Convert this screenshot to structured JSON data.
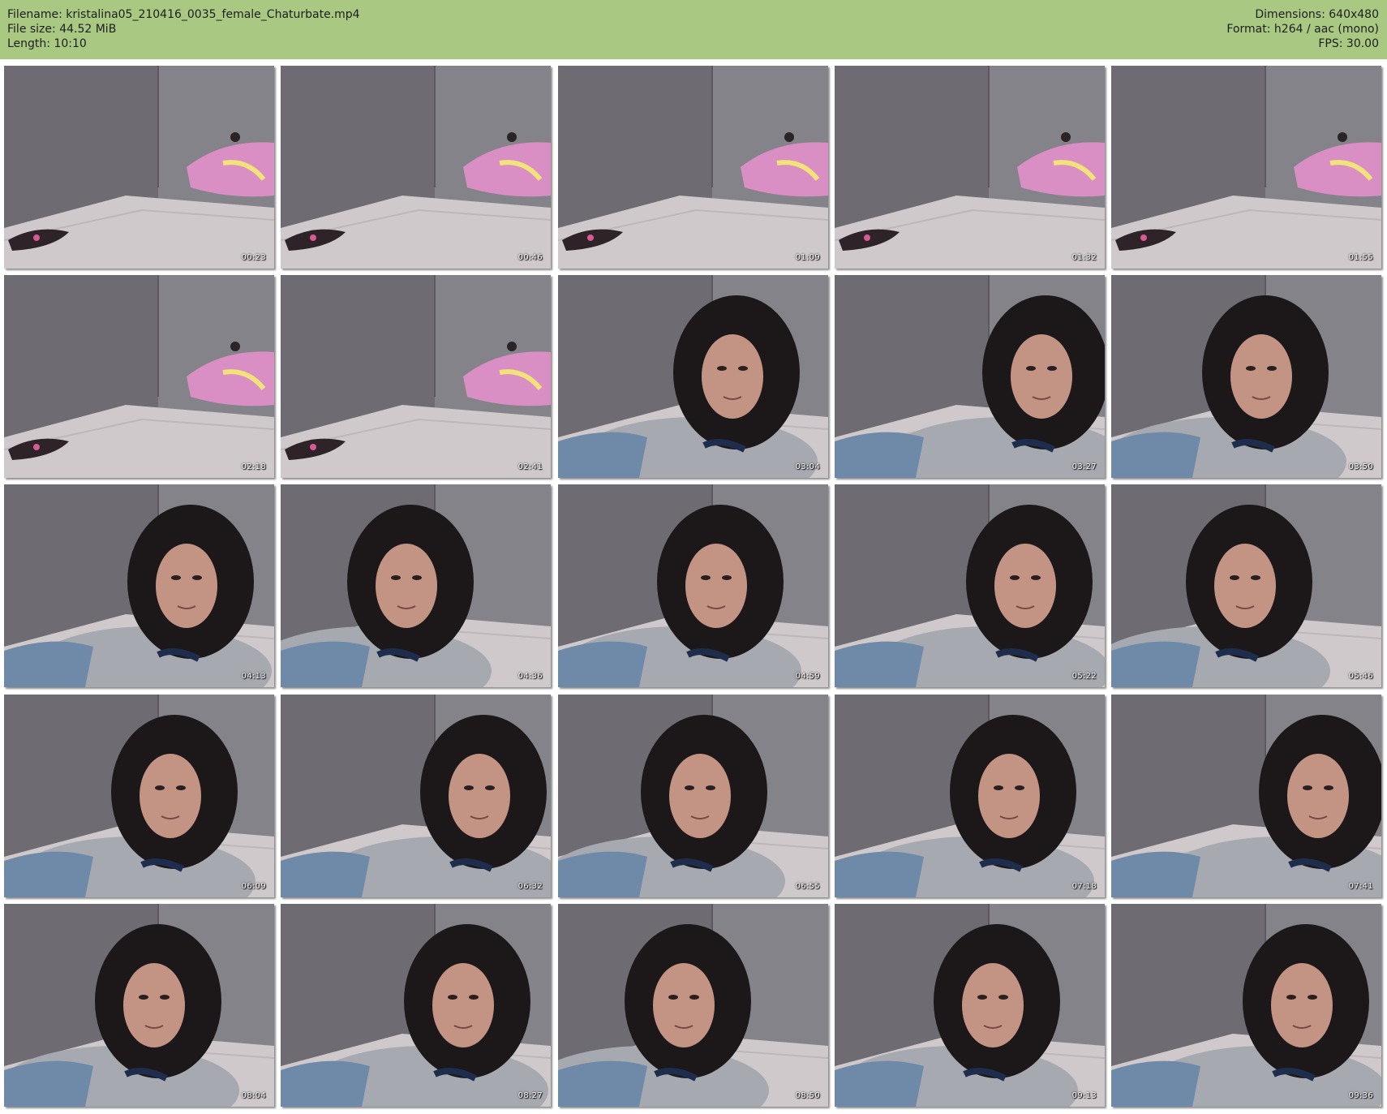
{
  "header": {
    "filename": "Filename: kristalina05_210416_0035_female_Chaturbate.mp4",
    "filesize": "File size: 44.52 MiB",
    "length": "Length: 10:10",
    "dimensions": "Dimensions: 640x480",
    "format": "Format: h264 / aac (mono)",
    "fps": "FPS: 30.00"
  },
  "thumbnails": [
    {
      "time": "00:23",
      "scene": "empty-bed"
    },
    {
      "time": "00:46",
      "scene": "empty-bed"
    },
    {
      "time": "01:09",
      "scene": "empty-bed"
    },
    {
      "time": "01:32",
      "scene": "empty-bed"
    },
    {
      "time": "01:55",
      "scene": "empty-bed"
    },
    {
      "time": "02:18",
      "scene": "empty-bed"
    },
    {
      "time": "02:41",
      "scene": "empty-bed"
    },
    {
      "time": "03:04",
      "scene": "person"
    },
    {
      "time": "03:27",
      "scene": "person"
    },
    {
      "time": "03:50",
      "scene": "person"
    },
    {
      "time": "04:13",
      "scene": "person"
    },
    {
      "time": "04:36",
      "scene": "person"
    },
    {
      "time": "04:59",
      "scene": "person"
    },
    {
      "time": "05:22",
      "scene": "person"
    },
    {
      "time": "05:46",
      "scene": "person"
    },
    {
      "time": "06:09",
      "scene": "person"
    },
    {
      "time": "06:32",
      "scene": "person"
    },
    {
      "time": "06:55",
      "scene": "person"
    },
    {
      "time": "07:18",
      "scene": "person"
    },
    {
      "time": "07:41",
      "scene": "person"
    },
    {
      "time": "08:04",
      "scene": "person"
    },
    {
      "time": "08:27",
      "scene": "person"
    },
    {
      "time": "08:50",
      "scene": "person"
    },
    {
      "time": "09:13",
      "scene": "person"
    },
    {
      "time": "09:36",
      "scene": "person"
    }
  ],
  "colors": {
    "header_bg": "#a9c983",
    "wall": "#76737a",
    "bed": "#cfc9cc",
    "pillow": "#d98fc4",
    "hoodie": "#a7a9b1",
    "hair": "#1c1719",
    "skin": "#c39484"
  }
}
